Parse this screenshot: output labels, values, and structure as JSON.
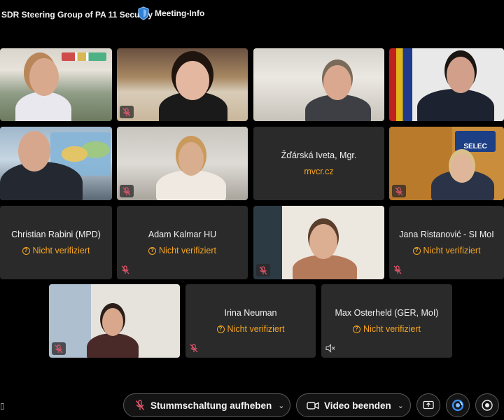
{
  "header": {
    "meeting_title": "SDR Steering Group of PA 11 Security",
    "meeting_info_label": "Meeting-Info"
  },
  "participants": [
    {
      "name": "Christian Rabini (MPD)",
      "status": "Nicht verifiziert"
    },
    {
      "name": "Adam Kalmar HU",
      "status": "Nicht verifiziert"
    },
    {
      "name": "Jana Ristanović - SI MoI",
      "status": "Nicht verifiziert"
    },
    {
      "name": "Žďárská Iveta, Mgr.",
      "status": "mvcr.cz"
    },
    {
      "name": "Irina Neuman",
      "status": "Nicht verifiziert"
    },
    {
      "name": "Max Osterheld (GER, MoI)",
      "status": "Nicht verifiziert"
    }
  ],
  "video_tiles": {
    "selec_logo_text": "SELEC"
  },
  "toolbar": {
    "unmute_label": "Stummschaltung aufheben",
    "stop_video_label": "Video beenden"
  },
  "icons": {
    "info": "shield-icon",
    "mic_off": "microphone-off-icon",
    "speaker_off": "speaker-muted-icon",
    "camera": "camera-icon",
    "share": "share-screen-icon",
    "assistant": "assistant-icon",
    "more": "record-icon"
  },
  "colors": {
    "background": "#000000",
    "tile": "#2a2a2a",
    "warning": "#f5a623",
    "mute_red": "#e0566b"
  }
}
